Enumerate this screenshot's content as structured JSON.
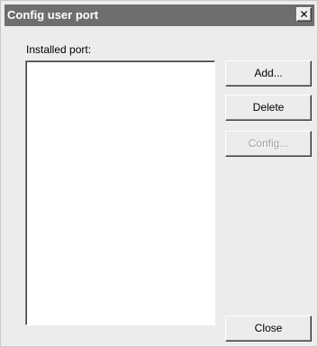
{
  "window": {
    "title": "Config user port",
    "close_glyph": "✕"
  },
  "main": {
    "installed_label": "Installed port:",
    "ports": []
  },
  "buttons": {
    "add_label": "Add...",
    "delete_label": "Delete",
    "config_label": "Config...",
    "config_enabled": false,
    "close_label": "Close"
  },
  "colors": {
    "titlebar": "#6e6e6e",
    "dialog_bg": "#ececec",
    "disabled_text": "#a0a0a0"
  }
}
